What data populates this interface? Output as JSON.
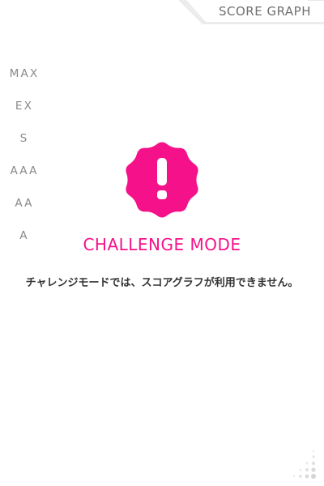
{
  "header": {
    "title": "SCORE GRAPH"
  },
  "ranks": [
    "MAX",
    "EX",
    "S",
    "AAA",
    "AA",
    "A"
  ],
  "challenge": {
    "title": "CHALLENGE MODE",
    "message": "チャレンジモードでは、スコアグラフが利用できません。",
    "badge_icon": "exclamation-badge-icon"
  },
  "colors": {
    "accent": "#f5118a",
    "rank_text": "#8a8a8a",
    "header_text": "#6f6f6f",
    "message_text": "#333333"
  }
}
